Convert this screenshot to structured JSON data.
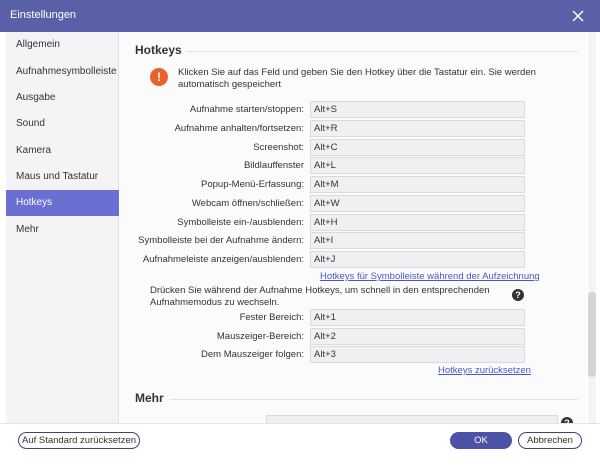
{
  "window": {
    "title": "Einstellungen"
  },
  "sidebar": {
    "items": [
      {
        "label": "Allgemein"
      },
      {
        "label": "Aufnahmesymbolleiste"
      },
      {
        "label": "Ausgabe"
      },
      {
        "label": "Sound"
      },
      {
        "label": "Kamera"
      },
      {
        "label": "Maus und Tastatur"
      },
      {
        "label": "Hotkeys",
        "active": true
      },
      {
        "label": "Mehr"
      }
    ]
  },
  "hotkeys": {
    "title": "Hotkeys",
    "info": "Klicken Sie auf das Feld und geben Sie den Hotkey über die Tastatur ein. Sie werden automatisch gespeichert",
    "rows": [
      {
        "label": "Aufnahme starten/stoppen:",
        "value": "Alt+S"
      },
      {
        "label": "Aufnahme anhalten/fortsetzen:",
        "value": "Alt+R"
      },
      {
        "label": "Screenshot:",
        "value": "Alt+C"
      },
      {
        "label": "Bildlauffenster",
        "value": "Alt+L"
      },
      {
        "label": "Popup-Menü-Erfassung:",
        "value": "Alt+M"
      },
      {
        "label": "Webcam öffnen/schließen:",
        "value": "Alt+W"
      },
      {
        "label": "Symbolleiste ein-/ausblenden:",
        "value": "Alt+H"
      },
      {
        "label": "Symbolleiste bei der Aufnahme ändern:",
        "value": "Alt+I"
      },
      {
        "label": "Aufnahmeleiste anzeigen/ausblenden:",
        "value": "Alt+J"
      }
    ],
    "toolbar_link": "Hotkeys für Symbolleiste während der Aufzeichnung",
    "mode_hint": "Drücken Sie während der Aufnahme Hotkeys, um schnell in den entsprechenden Aufnahmemodus zu wechseln.",
    "mode_rows": [
      {
        "label": "Fester Bereich:",
        "value": "Alt+1"
      },
      {
        "label": "Mauszeiger-Bereich:",
        "value": "Alt+2"
      },
      {
        "label": "Dem Mauszeiger folgen:",
        "value": "Alt+3"
      }
    ],
    "reset_link": "Hotkeys zurücksetzen"
  },
  "mehr": {
    "title": "Mehr"
  },
  "footer": {
    "reset_default": "Auf Standard zurücksetzen",
    "ok": "OK",
    "cancel": "Abbrechen"
  },
  "icons": {
    "warning": "exclamation-icon",
    "help": "question-icon",
    "close": "close-icon"
  },
  "colors": {
    "titlebar": "#5a60a8",
    "active_nav": "#6a6fd1",
    "primary_button": "#4c52a6",
    "warning": "#e9622e",
    "link": "#4a57c8"
  }
}
